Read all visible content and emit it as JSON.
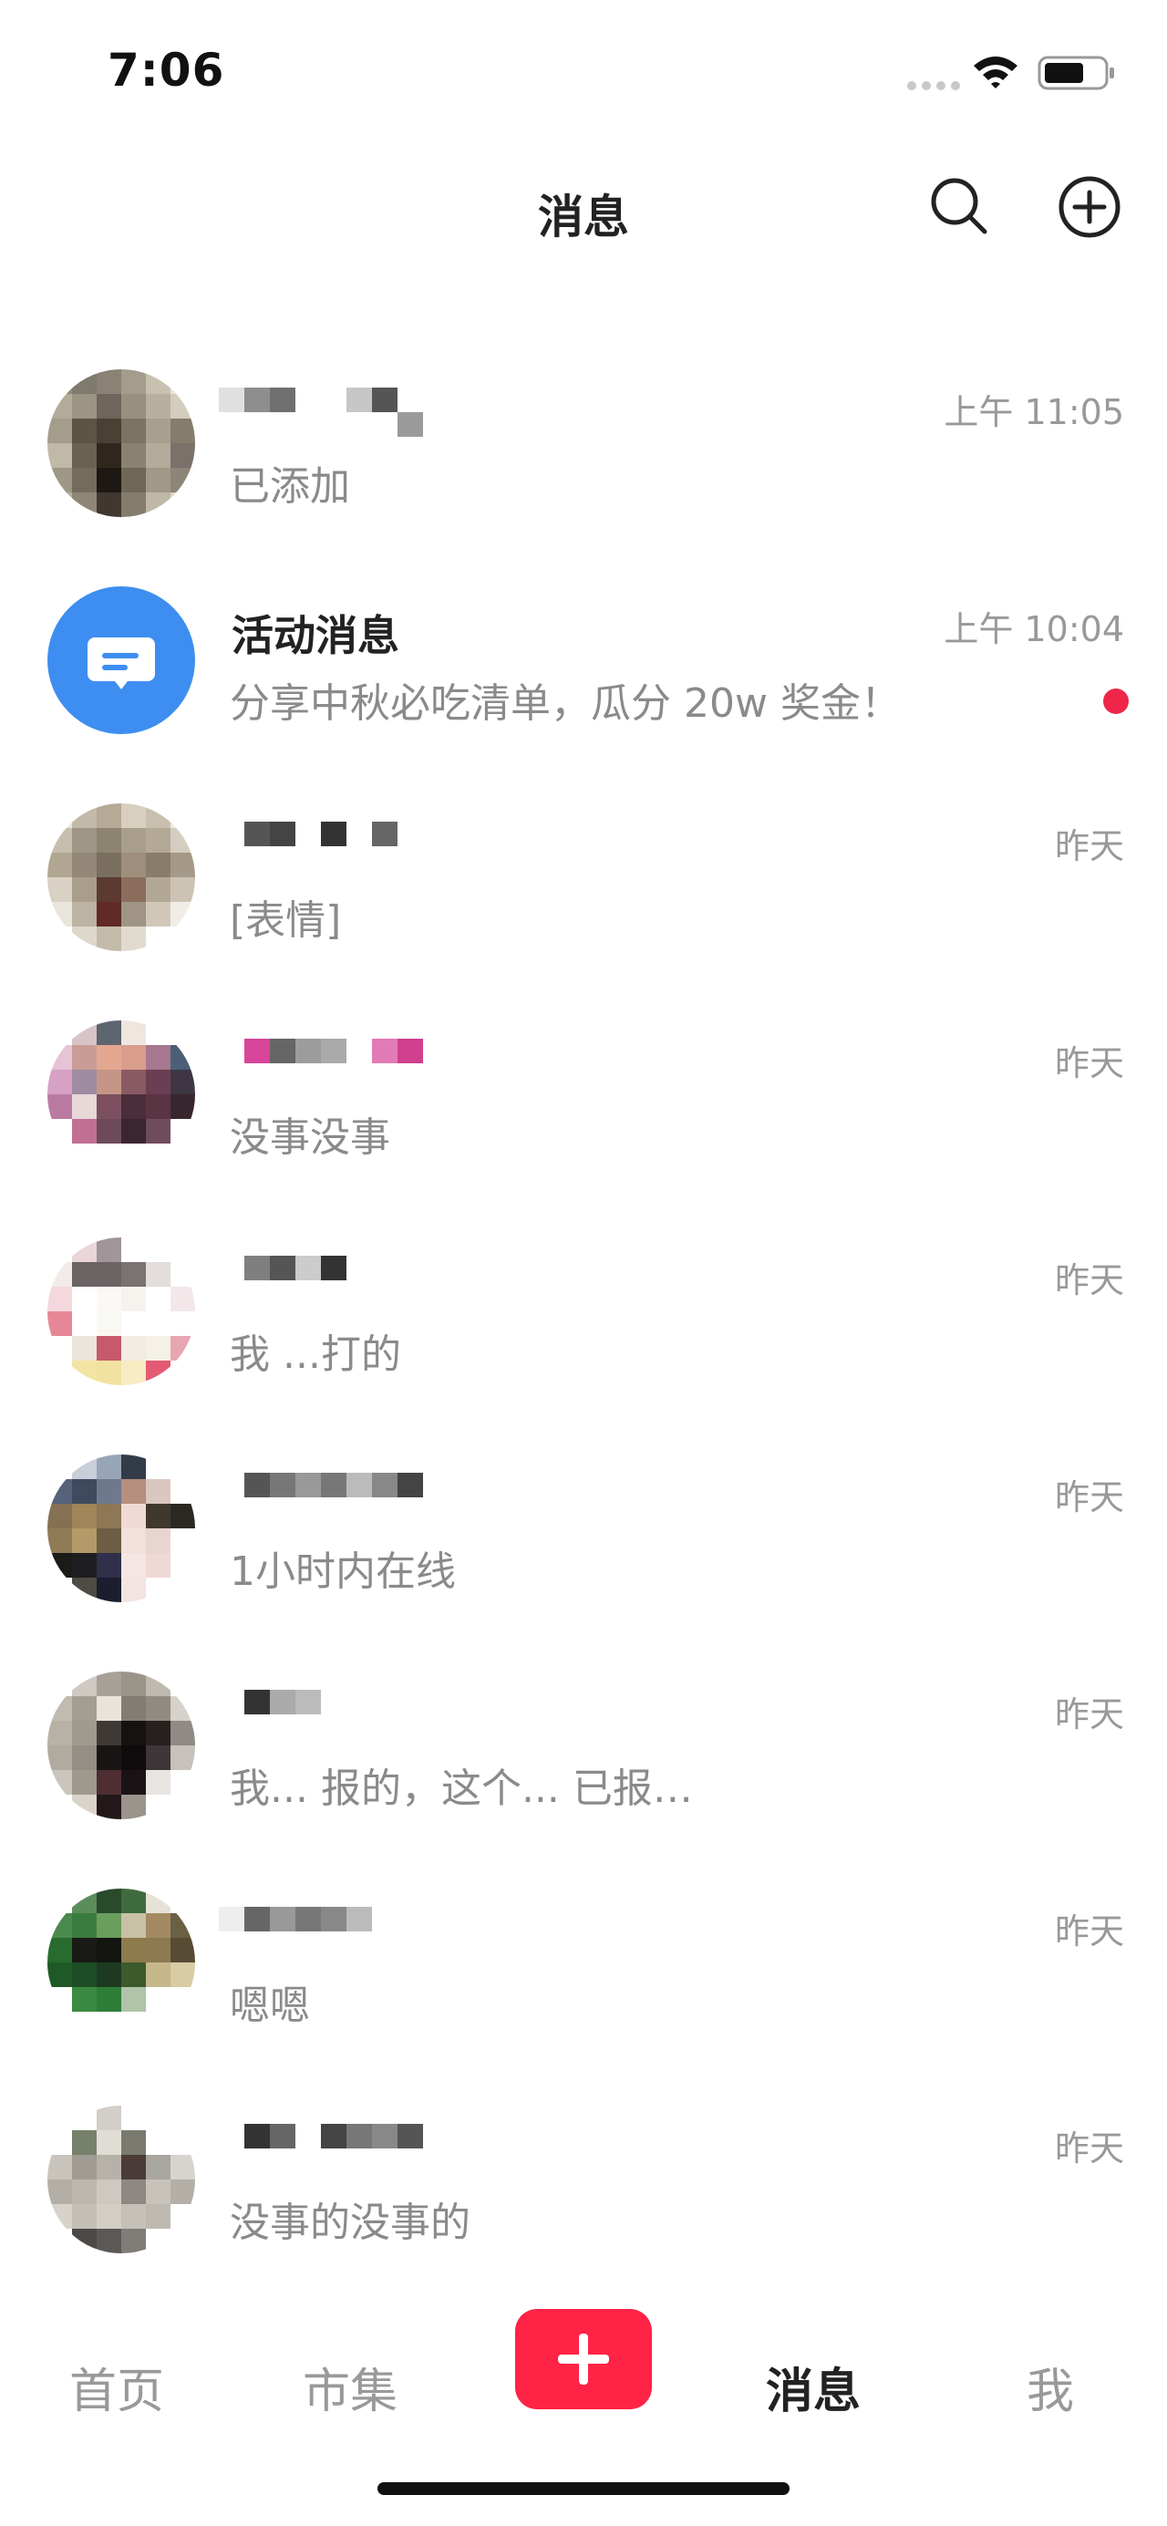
{
  "status_bar": {
    "time": "7:06",
    "icons": [
      "signal-icon",
      "wifi-icon",
      "battery-icon"
    ]
  },
  "header": {
    "title": "消息",
    "actions": [
      "search-icon",
      "add-icon"
    ]
  },
  "conversations": [
    {
      "name": "",
      "preview": "已添加",
      "time": "上午 11:05",
      "unread": false,
      "avatar": "pixelated-avatar"
    },
    {
      "name": "活动消息",
      "preview": "分享中秋必吃清单，瓜分 20w 奖金！",
      "time": "上午 10:04",
      "unread": true,
      "avatar": "activity-message-icon"
    },
    {
      "name": "",
      "preview": "[表情]",
      "time": "昨天",
      "unread": false,
      "avatar": "pixelated-avatar"
    },
    {
      "name": "",
      "preview": "没事没事",
      "time": "昨天",
      "unread": false,
      "avatar": "pixelated-avatar"
    },
    {
      "name": "",
      "preview": "我 ...打的",
      "time": "昨天",
      "unread": false,
      "avatar": "pixelated-avatar"
    },
    {
      "name": "",
      "preview": "1小时内在线",
      "time": "昨天",
      "unread": false,
      "avatar": "pixelated-avatar"
    },
    {
      "name": "",
      "preview": "我... 报的，这个... 已报…",
      "time": "昨天",
      "unread": false,
      "avatar": "pixelated-avatar"
    },
    {
      "name": "",
      "preview": "嗯嗯",
      "time": "昨天",
      "unread": false,
      "avatar": "pixelated-avatar"
    },
    {
      "name": "",
      "preview": "没事的没事的",
      "time": "昨天",
      "unread": false,
      "avatar": "pixelated-avatar"
    }
  ],
  "tab_bar": {
    "home": "首页",
    "market": "市集",
    "post": "post-plus-icon",
    "messages": "消息",
    "me": "我",
    "active": "messages"
  },
  "colors": {
    "accent": "#ff2345",
    "unread_dot": "#f0254a",
    "activity_avatar": "#3d8ef0",
    "secondary_text": "#8a8a8a"
  }
}
